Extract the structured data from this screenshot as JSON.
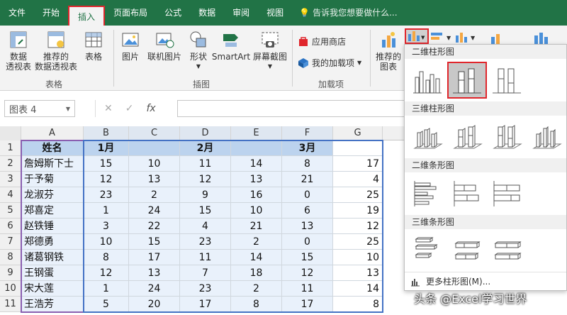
{
  "tabs": [
    "文件",
    "开始",
    "插入",
    "页面布局",
    "公式",
    "数据",
    "审阅",
    "视图"
  ],
  "active_tab_index": 2,
  "tell_me": "告诉我您想要做什么...",
  "ribbon": {
    "pivot_label": "数据\n透视表",
    "recommended_pivot_label": "推荐的\n数据透视表",
    "table_label": "表格",
    "group_table": "表格",
    "picture_label": "图片",
    "online_picture_label": "联机图片",
    "shapes_label": "形状",
    "smartart_label": "SmartArt",
    "screenshot_label": "屏幕截图",
    "group_illustrations": "插图",
    "store_label": "应用商店",
    "myaddins_label": "我的加载项",
    "group_addins": "加载项",
    "recommended_chart_label": "推荐的\n图表"
  },
  "namebox": "图表 4",
  "fx": "fx",
  "columns": [
    "A",
    "B",
    "C",
    "D",
    "E",
    "F",
    "G"
  ],
  "rows": [
    "1",
    "2",
    "3",
    "4",
    "5",
    "6",
    "7",
    "8",
    "9",
    "10",
    "11"
  ],
  "header_row": [
    "姓名",
    "1月",
    "",
    "2月",
    "",
    "3月",
    ""
  ],
  "data_rows": [
    [
      "詹姆斯下士",
      "15",
      "10",
      "11",
      "14",
      "8",
      "17"
    ],
    [
      "于予菊",
      "12",
      "13",
      "12",
      "13",
      "21",
      "4"
    ],
    [
      "龙淑芬",
      "23",
      "2",
      "9",
      "16",
      "0",
      "25"
    ],
    [
      "郑喜定",
      "1",
      "24",
      "15",
      "10",
      "6",
      "19"
    ],
    [
      "赵铁锤",
      "3",
      "22",
      "4",
      "21",
      "13",
      "12"
    ],
    [
      "郑德勇",
      "10",
      "15",
      "23",
      "2",
      "0",
      "25"
    ],
    [
      "诸葛钢铁",
      "8",
      "17",
      "11",
      "14",
      "15",
      "10"
    ],
    [
      "王钢蛋",
      "12",
      "13",
      "7",
      "18",
      "12",
      "13"
    ],
    [
      "宋大莲",
      "1",
      "24",
      "23",
      "2",
      "11",
      "14"
    ],
    [
      "王浩芳",
      "5",
      "20",
      "17",
      "8",
      "17",
      "8"
    ]
  ],
  "dropdown": {
    "sec_2d_column": "二维柱形图",
    "sec_3d_column": "三维柱形图",
    "sec_2d_bar": "二维条形图",
    "sec_3d_bar": "三维条形图",
    "more": "更多柱形图(M)..."
  },
  "watermark": "头条 @Excel学习世界",
  "colors": {
    "excel_green": "#217346",
    "highlight_red": "#e0262c",
    "selection_blue": "#4472c4"
  }
}
